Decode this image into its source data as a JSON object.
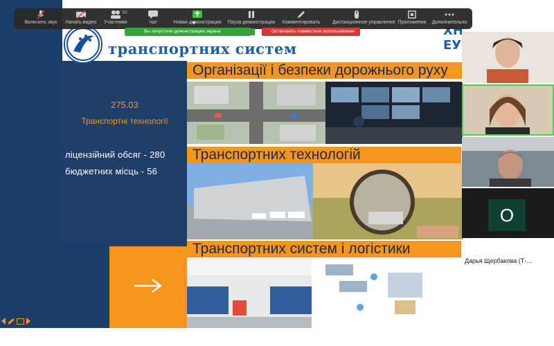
{
  "toolbar": {
    "items": [
      {
        "label": "Включить звук",
        "icon": "microphone-muted-icon"
      },
      {
        "label": "Начать видео",
        "icon": "video-off-icon"
      },
      {
        "label": "Участники",
        "icon": "participants-icon",
        "count": "98"
      },
      {
        "label": "Чат",
        "icon": "chat-icon"
      },
      {
        "label": "Новая демонстрация",
        "icon": "share-screen-icon",
        "accent": "#37c33c"
      },
      {
        "label": "Пауза демонстрации",
        "icon": "pause-icon"
      },
      {
        "label": "Комментировать",
        "icon": "annotate-pen-icon"
      },
      {
        "label": "Дистанционное управление",
        "icon": "remote-control-icon"
      },
      {
        "label": "Приложения",
        "icon": "apps-icon"
      },
      {
        "label": "Дополнительно",
        "icon": "more-icon"
      }
    ],
    "sharing_notice": "Вы запустили демонстрацию экрана",
    "stop_sharing": "Остановить совместное использование"
  },
  "slide": {
    "header_title": "транспортних систем",
    "hnu_logo_text": "ХНУ ЕУ",
    "code": "275.03",
    "specialty": "Транспортні технології",
    "licensed_volume": "ліцензійний обсяг - 280",
    "budget_places": "бюджетних місць - 56",
    "bands": [
      "Організації і безпеки дорожнього руху",
      "Транспортних технологій",
      "Транспортних систем і логістики"
    ],
    "arrow": "→"
  },
  "participants": {
    "o_initial": "О",
    "name": "Дарья Щербакова (Т-…"
  },
  "colors": {
    "slide_blue": "#1f3f6a",
    "slide_orange": "#f7941d",
    "toolbar_bg": "#2a2a2a",
    "sharing_green": "#37a33c",
    "stop_red": "#d63a37",
    "active_speaker": "#4ad04a"
  }
}
